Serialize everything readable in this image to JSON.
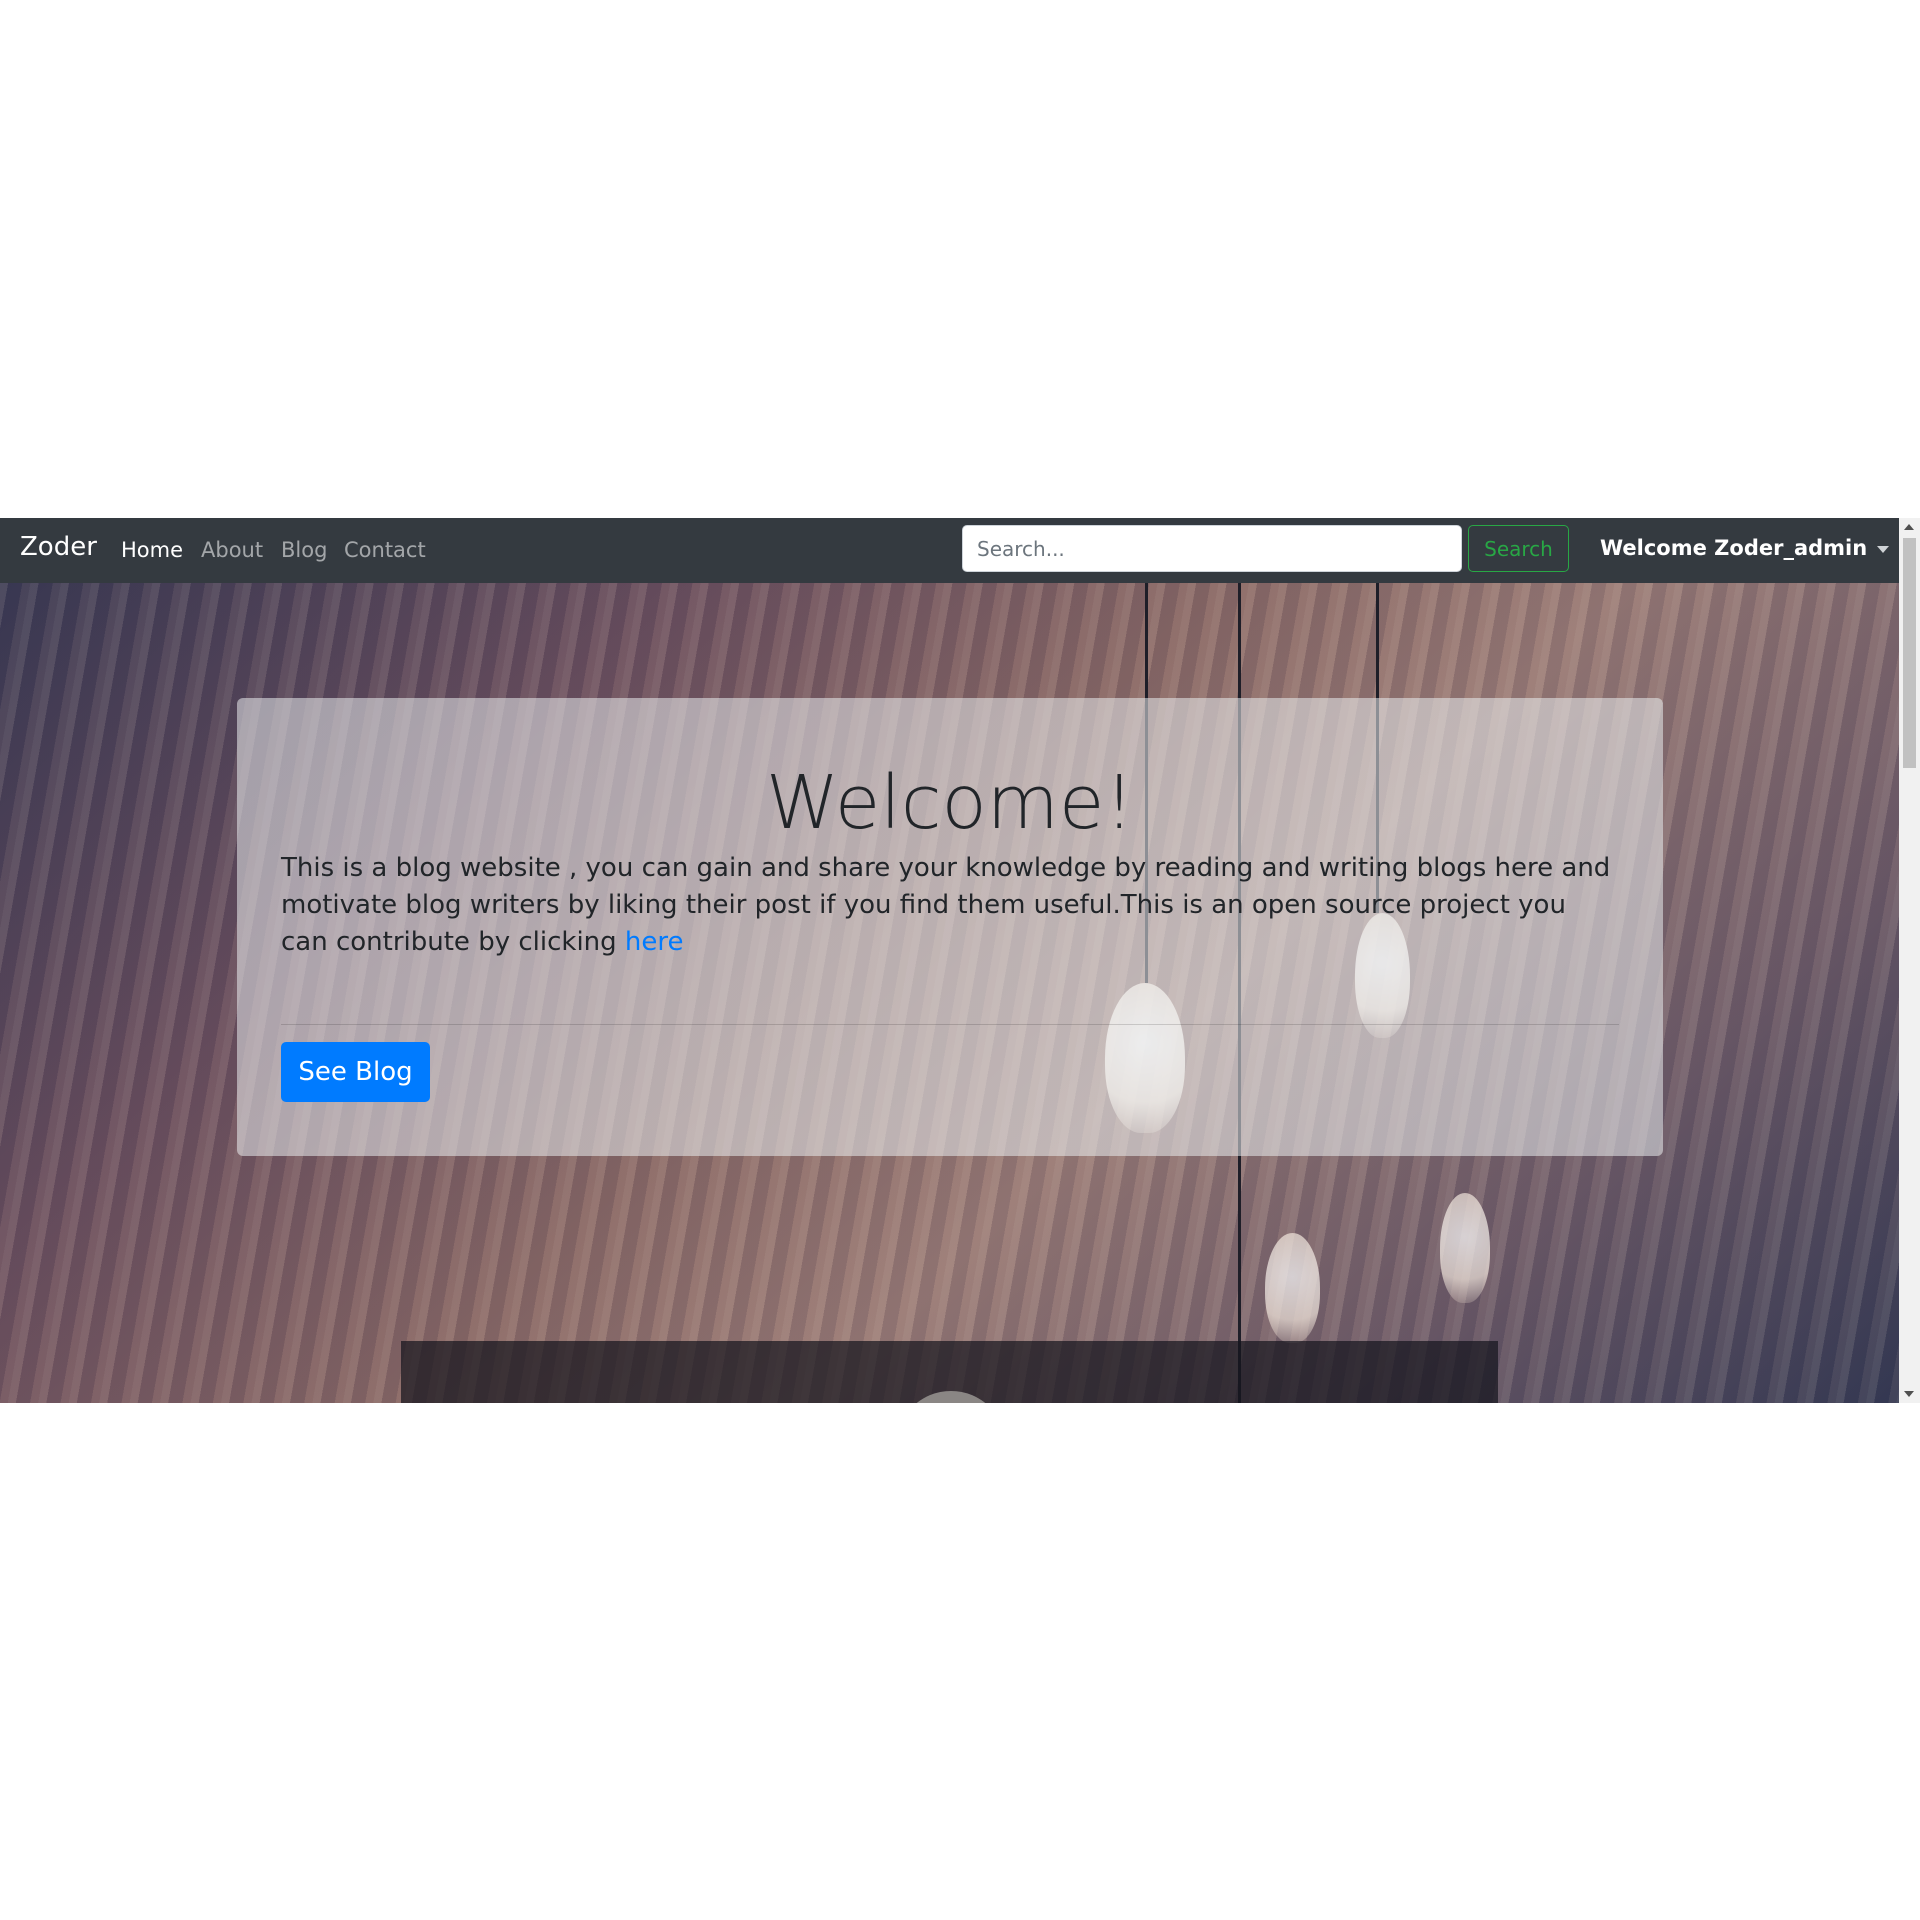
{
  "navbar": {
    "brand": "Zoder",
    "links": [
      {
        "label": "Home",
        "active": true
      },
      {
        "label": "About",
        "active": false
      },
      {
        "label": "Blog",
        "active": false
      },
      {
        "label": "Contact",
        "active": false
      }
    ],
    "search": {
      "placeholder": "Search...",
      "button_label": "Search"
    },
    "user_menu_label": "Welcome Zoder_admin"
  },
  "hero": {
    "title": "Welcome!",
    "text_before_link": "This is a blog website , you can gain and share your knowledge by reading and writing blogs here and motivate blog writers by liking their post if you find them useful.This is an open source project you can contribute by clicking ",
    "link_label": "here",
    "button_label": "See Blog"
  },
  "colors": {
    "navbar_bg": "#343a40",
    "primary": "#007bff",
    "success": "#28a745"
  }
}
